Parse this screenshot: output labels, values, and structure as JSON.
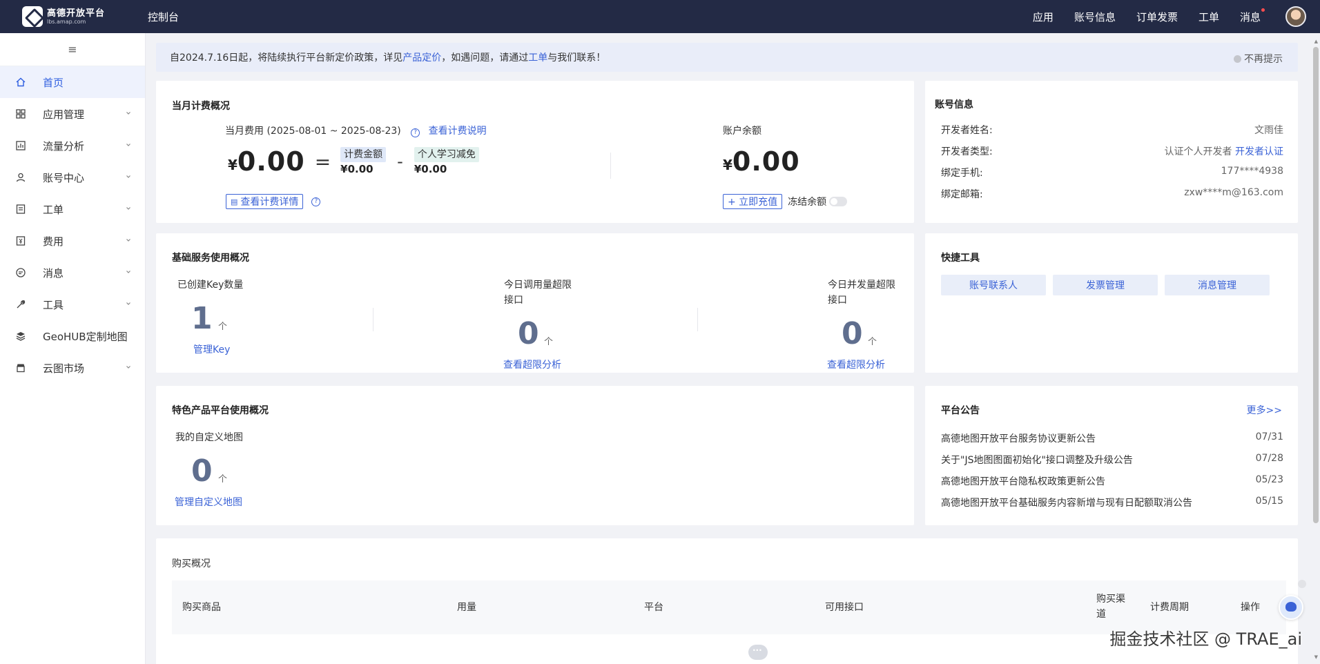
{
  "topbar": {
    "logo_title": "高德开放平台",
    "logo_sub": "lbs.amap.com",
    "console": "控制台",
    "nav": [
      "应用",
      "账号信息",
      "订单发票",
      "工单",
      "消息"
    ]
  },
  "sidebar": {
    "menu_icon": "≡",
    "items": [
      {
        "label": "首页",
        "icon": "home-icon"
      },
      {
        "label": "应用管理",
        "icon": "grid-icon"
      },
      {
        "label": "流量分析",
        "icon": "chart-icon"
      },
      {
        "label": "账号中心",
        "icon": "user-icon"
      },
      {
        "label": "工单",
        "icon": "ticket-icon"
      },
      {
        "label": "费用",
        "icon": "bill-icon"
      },
      {
        "label": "消息",
        "icon": "message-icon"
      },
      {
        "label": "工具",
        "icon": "wrench-icon"
      },
      {
        "label": "GeoHUB定制地图",
        "icon": "layers-icon"
      },
      {
        "label": "云图市场",
        "icon": "store-icon"
      }
    ]
  },
  "notice": {
    "pre": "自2024.7.16日起，将陆续执行平台新定价政策，详见",
    "link1": "产品定价",
    "mid": "，如遇问题，请通过",
    "link2": "工单",
    "post": "与我们联系！",
    "close": "不再提示"
  },
  "billing": {
    "title": "当月计费概况",
    "period_label": "当月费用 (2025-08-01 ~ 2025-08-23)",
    "explain_link": "查看计费说明",
    "yen": "¥",
    "total": "0.00",
    "equals": "=",
    "minus": "-",
    "fee_label": "计费金额",
    "fee_value": "¥0.00",
    "discount_label": "个人学习减免",
    "discount_value": "¥0.00",
    "detail_btn": "查看计费详情",
    "balance_label": "账户余额",
    "balance": "0.00",
    "recharge_btn": "+ 立即充值",
    "frozen_label": "冻结余额"
  },
  "account": {
    "title": "账号信息",
    "rows": [
      {
        "k": "开发者姓名:",
        "v": "文雨佳"
      },
      {
        "k": "开发者类型:",
        "v": "认证个人开发者"
      },
      {
        "k": "绑定手机:",
        "v": "177****4938"
      },
      {
        "k": "绑定邮箱:",
        "v": "zxw****m@163.com"
      }
    ],
    "verify_link": "开发者认证"
  },
  "basic": {
    "title": "基础服务使用概况",
    "key_label": "已创建Key数量",
    "key_count": "1",
    "unit": "个",
    "key_link": "管理Key",
    "daily_label_1": "今日调用量超限",
    "daily_label_2": "接口",
    "daily_count": "0",
    "daily_link": "查看超限分析",
    "concurrent_label_1": "今日并发量超限",
    "concurrent_label_2": "接口",
    "concurrent_count": "0",
    "concurrent_link": "查看超限分析"
  },
  "quick": {
    "title": "快捷工具",
    "buttons": [
      "账号联系人",
      "发票管理",
      "消息管理"
    ]
  },
  "special": {
    "title": "特色产品平台使用概况",
    "map_label": "我的自定义地图",
    "map_count": "0",
    "unit": "个",
    "map_link": "管理自定义地图"
  },
  "announce": {
    "title": "平台公告",
    "more": "更多>>",
    "items": [
      {
        "text": "高德地图开放平台服务协议更新公告",
        "date": "07/31"
      },
      {
        "text": "关于\"JS地图图面初始化\"接口调整及升级公告",
        "date": "07/28"
      },
      {
        "text": "高德地图开放平台隐私权政策更新公告",
        "date": "05/23"
      },
      {
        "text": "高德地图开放平台基础服务内容新增与现有日配额取消公告",
        "date": "05/15"
      }
    ]
  },
  "purchase": {
    "title": "购买概况",
    "cols": [
      "购买商品",
      "用量",
      "平台",
      "可用接口",
      "购买渠",
      "道",
      "计费周期",
      "操作"
    ]
  },
  "watermark": "掘金技术社区 @ TRAE_ai"
}
